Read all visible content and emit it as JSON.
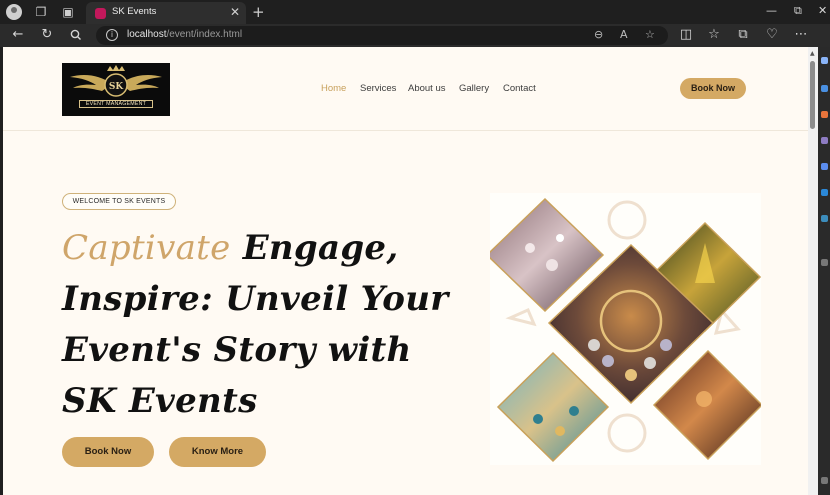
{
  "browser": {
    "tab_title": "SK Events",
    "address_host": "localhost",
    "address_path": "/event/index.html",
    "read_aloud_label": "A",
    "tab_close": "✕",
    "new_tab": "+",
    "minimize": "—",
    "restore": "⧉",
    "close": "✕",
    "more": "⋯"
  },
  "logo": {
    "monogram": "SK",
    "caption": "EVENT MANAGEMENT"
  },
  "nav": {
    "home": "Home",
    "services": "Services",
    "about": "About us",
    "gallery": "Gallery",
    "contact": "Contact",
    "book_now": "Book Now"
  },
  "hero": {
    "badge": "WELCOME TO SK EVENTS",
    "headline_accent": "Captivate",
    "headline_rest": " Engage, Inspire: Unveil Your Event's Story with SK Events",
    "primary_button": "Book Now",
    "secondary_button": "Know More"
  },
  "colors": {
    "accent": "#d4a964",
    "headline_accent": "#cfa56a",
    "page_background": "#fffaf3",
    "active_nav": "#c8a15d"
  },
  "icons": [
    "back-icon",
    "refresh-icon",
    "search-icon",
    "info-icon",
    "zoom-icon",
    "favorite-icon",
    "collections-icon",
    "split-screen-icon"
  ]
}
